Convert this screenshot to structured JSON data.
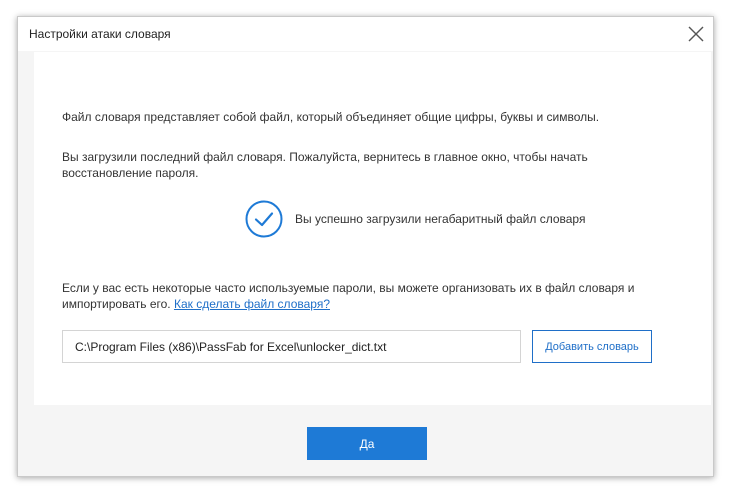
{
  "dialog": {
    "title": "Настройки атаки словаря",
    "close_icon": "close-icon"
  },
  "content": {
    "paragraph1": "Файл словаря представляет собой файл, который объединяет общие цифры, буквы и символы.",
    "paragraph2": "Вы загрузили последний файл словаря. Пожалуйста, вернитесь в главное окно, чтобы начать восстановление пароля.",
    "success_icon": "check-circle-icon",
    "success_text": "Вы успешно загрузили негабаритный файл словаря",
    "paragraph3": "Если у вас есть некоторые часто используемые пароли, вы можете организовать их в файл словаря и импортировать его.",
    "help_link": "Как сделать файл словаря?",
    "path_value": "C:\\Program Files (x86)\\PassFab for Excel\\unlocker_dict.txt",
    "add_button": "Добавить словарь"
  },
  "footer": {
    "ok_button": "Да"
  },
  "colors": {
    "accent": "#1e7ad6",
    "link": "#1f6fc8",
    "background": "#f5f5f5"
  }
}
